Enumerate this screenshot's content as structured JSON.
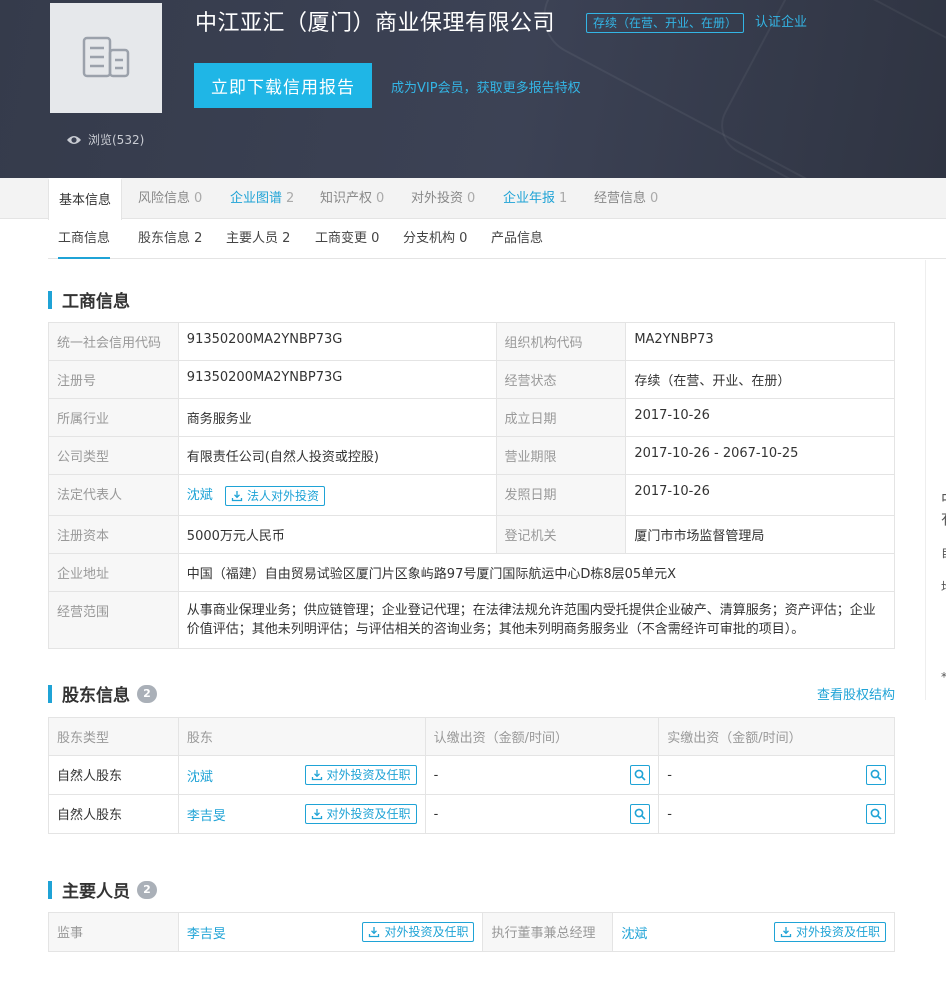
{
  "header": {
    "company_name": "中江亚汇（厦门）商业保理有限公司",
    "status_tag": "存续（在营、开业、在册）",
    "verified": "认证企业",
    "download_button": "立即下载信用报告",
    "vip_link": "成为VIP会员，获取更多报告特权",
    "views": "浏览(532)"
  },
  "tabs": [
    {
      "label": "基本信息",
      "count": ""
    },
    {
      "label": "风险信息",
      "count": "0"
    },
    {
      "label": "企业图谱",
      "count": "2"
    },
    {
      "label": "知识产权",
      "count": "0"
    },
    {
      "label": "对外投资",
      "count": "0"
    },
    {
      "label": "企业年报",
      "count": "1"
    },
    {
      "label": "经营信息",
      "count": "0"
    }
  ],
  "subtabs": [
    {
      "label": "工商信息"
    },
    {
      "label": "股东信息 2"
    },
    {
      "label": "主要人员 2"
    },
    {
      "label": "工商变更 0"
    },
    {
      "label": "分支机构 0"
    },
    {
      "label": "产品信息"
    }
  ],
  "business": {
    "title": "工商信息",
    "rows": [
      [
        "统一社会信用代码",
        "91350200MA2YNBP73G",
        "组织机构代码",
        "MA2YNBP73"
      ],
      [
        "注册号",
        "91350200MA2YNBP73G",
        "经营状态",
        "存续（在营、开业、在册）"
      ],
      [
        "所属行业",
        "商务服务业",
        "成立日期",
        "2017-10-26"
      ],
      [
        "公司类型",
        "有限责任公司(自然人投资或控股)",
        "营业期限",
        "2017-10-26 - 2067-10-25"
      ],
      [
        "法定代表人",
        "沈斌",
        "发照日期",
        "2017-10-26"
      ],
      [
        "注册资本",
        "5000万元人民币",
        "登记机关",
        "厦门市市场监督管理局"
      ]
    ],
    "legal_rep_button": "法人对外投资",
    "address_label": "企业地址",
    "address": "中国（福建）自由贸易试验区厦门片区象屿路97号厦门国际航运中心D栋8层05单元X",
    "scope_label": "经营范围",
    "scope": "从事商业保理业务；供应链管理；企业登记代理；在法律法规允许范围内受托提供企业破产、清算服务；资产评估；企业价值评估；其他未列明评估；与评估相关的咨询业务；其他未列明商务服务业（不含需经许可审批的项目）。"
  },
  "shareholders": {
    "title": "股东信息",
    "count": "2",
    "link": "查看股权结构",
    "headers": [
      "股东类型",
      "股东",
      "认缴出资（金额/时间）",
      "实缴出资（金额/时间）"
    ],
    "button": "对外投资及任职",
    "rows": [
      {
        "type": "自然人股东",
        "name": "沈斌",
        "subscribed": "-",
        "paid": "-"
      },
      {
        "type": "自然人股东",
        "name": "李吉旻",
        "subscribed": "-",
        "paid": "-"
      }
    ]
  },
  "personnel": {
    "title": "主要人员",
    "count": "2",
    "button": "对外投资及任职",
    "items": [
      {
        "role": "监事",
        "name": "李吉旻"
      },
      {
        "role": "执行董事兼总经理",
        "name": "沈斌"
      }
    ]
  },
  "ghost_panel": [
    "中",
    "有",
    "自",
    "均",
    "*"
  ],
  "colors": {
    "accent": "#1fa3d6",
    "header_bg": "#3a4052",
    "button": "#1fb6e6"
  }
}
